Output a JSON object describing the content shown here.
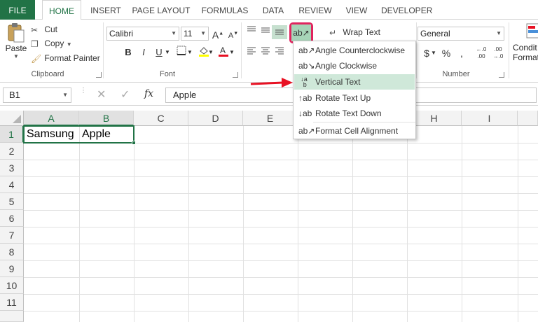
{
  "tabs": {
    "file": "FILE",
    "home": "HOME",
    "insert": "INSERT",
    "page_layout": "PAGE LAYOUT",
    "formulas": "FORMULAS",
    "data": "DATA",
    "review": "REVIEW",
    "view": "VIEW",
    "developer": "DEVELOPER"
  },
  "clipboard": {
    "paste": "Paste",
    "cut": "Cut",
    "copy": "Copy",
    "format_painter": "Format Painter",
    "label": "Clipboard"
  },
  "font": {
    "name": "Calibri",
    "size": "11",
    "label": "Font",
    "bold": "B",
    "italic": "I",
    "underline": "U"
  },
  "alignment": {
    "wrap_text": "Wrap Text"
  },
  "number": {
    "format": "General",
    "label": "Number",
    "currency": "$",
    "percent": "%",
    "comma": ","
  },
  "styles": {
    "conditional_line1": "Condit",
    "conditional_line2": "Formatt"
  },
  "formula_bar": {
    "name_box": "B1",
    "fx": "fx",
    "value": "Apple"
  },
  "columns": [
    "A",
    "B",
    "C",
    "D",
    "E",
    "F",
    "G",
    "H",
    "I"
  ],
  "rows": [
    "1",
    "2",
    "3",
    "4",
    "5",
    "6",
    "7",
    "8",
    "9",
    "10",
    "11"
  ],
  "cells": {
    "A1": "Samsung",
    "B1": "Apple"
  },
  "orientation_menu": {
    "items": [
      {
        "label": "Angle Counterclockwise",
        "icon": "angle-ccw-icon"
      },
      {
        "label": "Angle Clockwise",
        "icon": "angle-cw-icon"
      },
      {
        "label": "Vertical Text",
        "icon": "vertical-text-icon"
      },
      {
        "label": "Rotate Text Up",
        "icon": "rotate-up-icon"
      },
      {
        "label": "Rotate Text Down",
        "icon": "rotate-down-icon"
      },
      {
        "label": "Format Cell Alignment",
        "icon": "format-alignment-icon"
      }
    ],
    "highlighted": "Vertical Text"
  },
  "colors": {
    "excel_green": "#217346",
    "highlight_box": "#e0245e",
    "arrow_red": "#e81123",
    "menu_highlight": "#cfe8d9"
  }
}
